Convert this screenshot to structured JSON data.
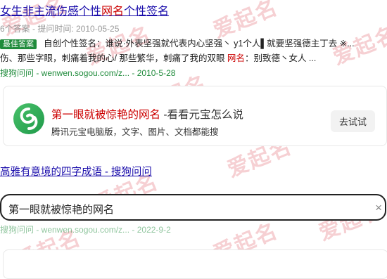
{
  "result1": {
    "title_prefix": "女生非主流伤感个性",
    "title_highlight": "网名",
    "title_suffix": "个性签名",
    "meta": "6个答案 - 提问时间: 2010-05-25",
    "best_badge": "最佳答案",
    "best_text": "自创个性签名：谁说·外表坚强就代表内心坚强丶 y1个人▌就要坚强德主丁去 ※...",
    "line2_text": "伤、那些字眼，刺痛着我的心/ 那些繁华，刺痛了我的双眼 ",
    "line2_highlight": "网名",
    "line2_suffix": "：别致德丶女人 ...",
    "source": "搜狗问问 - wenwen.sogou.com/z... - 2010-5-28"
  },
  "app_card": {
    "title_highlight": "第一眼就被惊艳的网名",
    "title_rest": " -看看元宝怎么说",
    "subtitle": "腾讯元宝电脑版，文字、图片、文档都能搜",
    "button_label": "去试试"
  },
  "result2": {
    "title": "高雅有意境的四字成语 - 搜狗问问"
  },
  "search": {
    "value": "第一眼就被惊艳的网名",
    "clear_icon": "×"
  },
  "ghost_source": "搜狗问问 - wenwen.sogou.com/z... - 2022-9-2",
  "watermark": "爱起名"
}
